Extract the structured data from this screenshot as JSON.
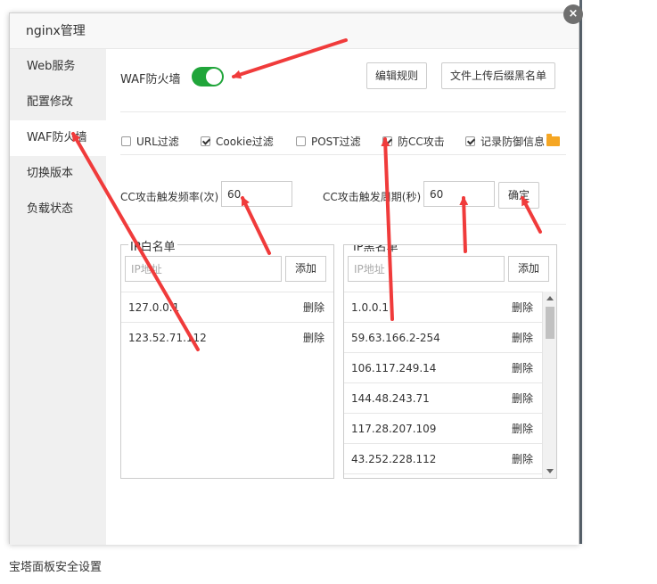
{
  "dialog": {
    "title": "nginx管理",
    "close_symbol": "×"
  },
  "sidebar": {
    "items": [
      {
        "label": "Web服务"
      },
      {
        "label": "配置修改"
      },
      {
        "label": "WAF防火墙",
        "active": true
      },
      {
        "label": "切换版本"
      },
      {
        "label": "负载状态"
      }
    ]
  },
  "waf": {
    "label": "WAF防火墙",
    "enabled": true,
    "edit_rules_button": "编辑规则",
    "upload_blacklist_button": "文件上传后缀黑名单"
  },
  "filters": [
    {
      "label": "URL过滤",
      "checked": false
    },
    {
      "label": "Cookie过滤",
      "checked": true
    },
    {
      "label": "POST过滤",
      "checked": false
    },
    {
      "label": "防CC攻击",
      "checked": true
    },
    {
      "label": "记录防御信息",
      "checked": true
    }
  ],
  "cc": {
    "frequency_label": "CC攻击触发频率(次)",
    "frequency_value": "60",
    "period_label": "CC攻击触发周期(秒)",
    "period_value": "60",
    "confirm_button": "确定"
  },
  "whitelist": {
    "title": "IP白名单",
    "placeholder": "IP地址",
    "add_button": "添加",
    "delete_label": "删除",
    "items": [
      "127.0.0.1",
      "123.52.71.112"
    ]
  },
  "blacklist": {
    "title": "IP黑名单",
    "placeholder": "IP地址",
    "add_button": "添加",
    "delete_label": "删除",
    "items": [
      "1.0.0.1",
      "59.63.166.2-254",
      "106.117.249.14",
      "144.48.243.71",
      "117.28.207.109",
      "43.252.228.112"
    ]
  },
  "footer": {
    "text": "宝塔面板安全设置"
  },
  "colors": {
    "toggle_on": "#20a53a",
    "arrow": "#f03b3b",
    "folder": "#f5a623"
  }
}
